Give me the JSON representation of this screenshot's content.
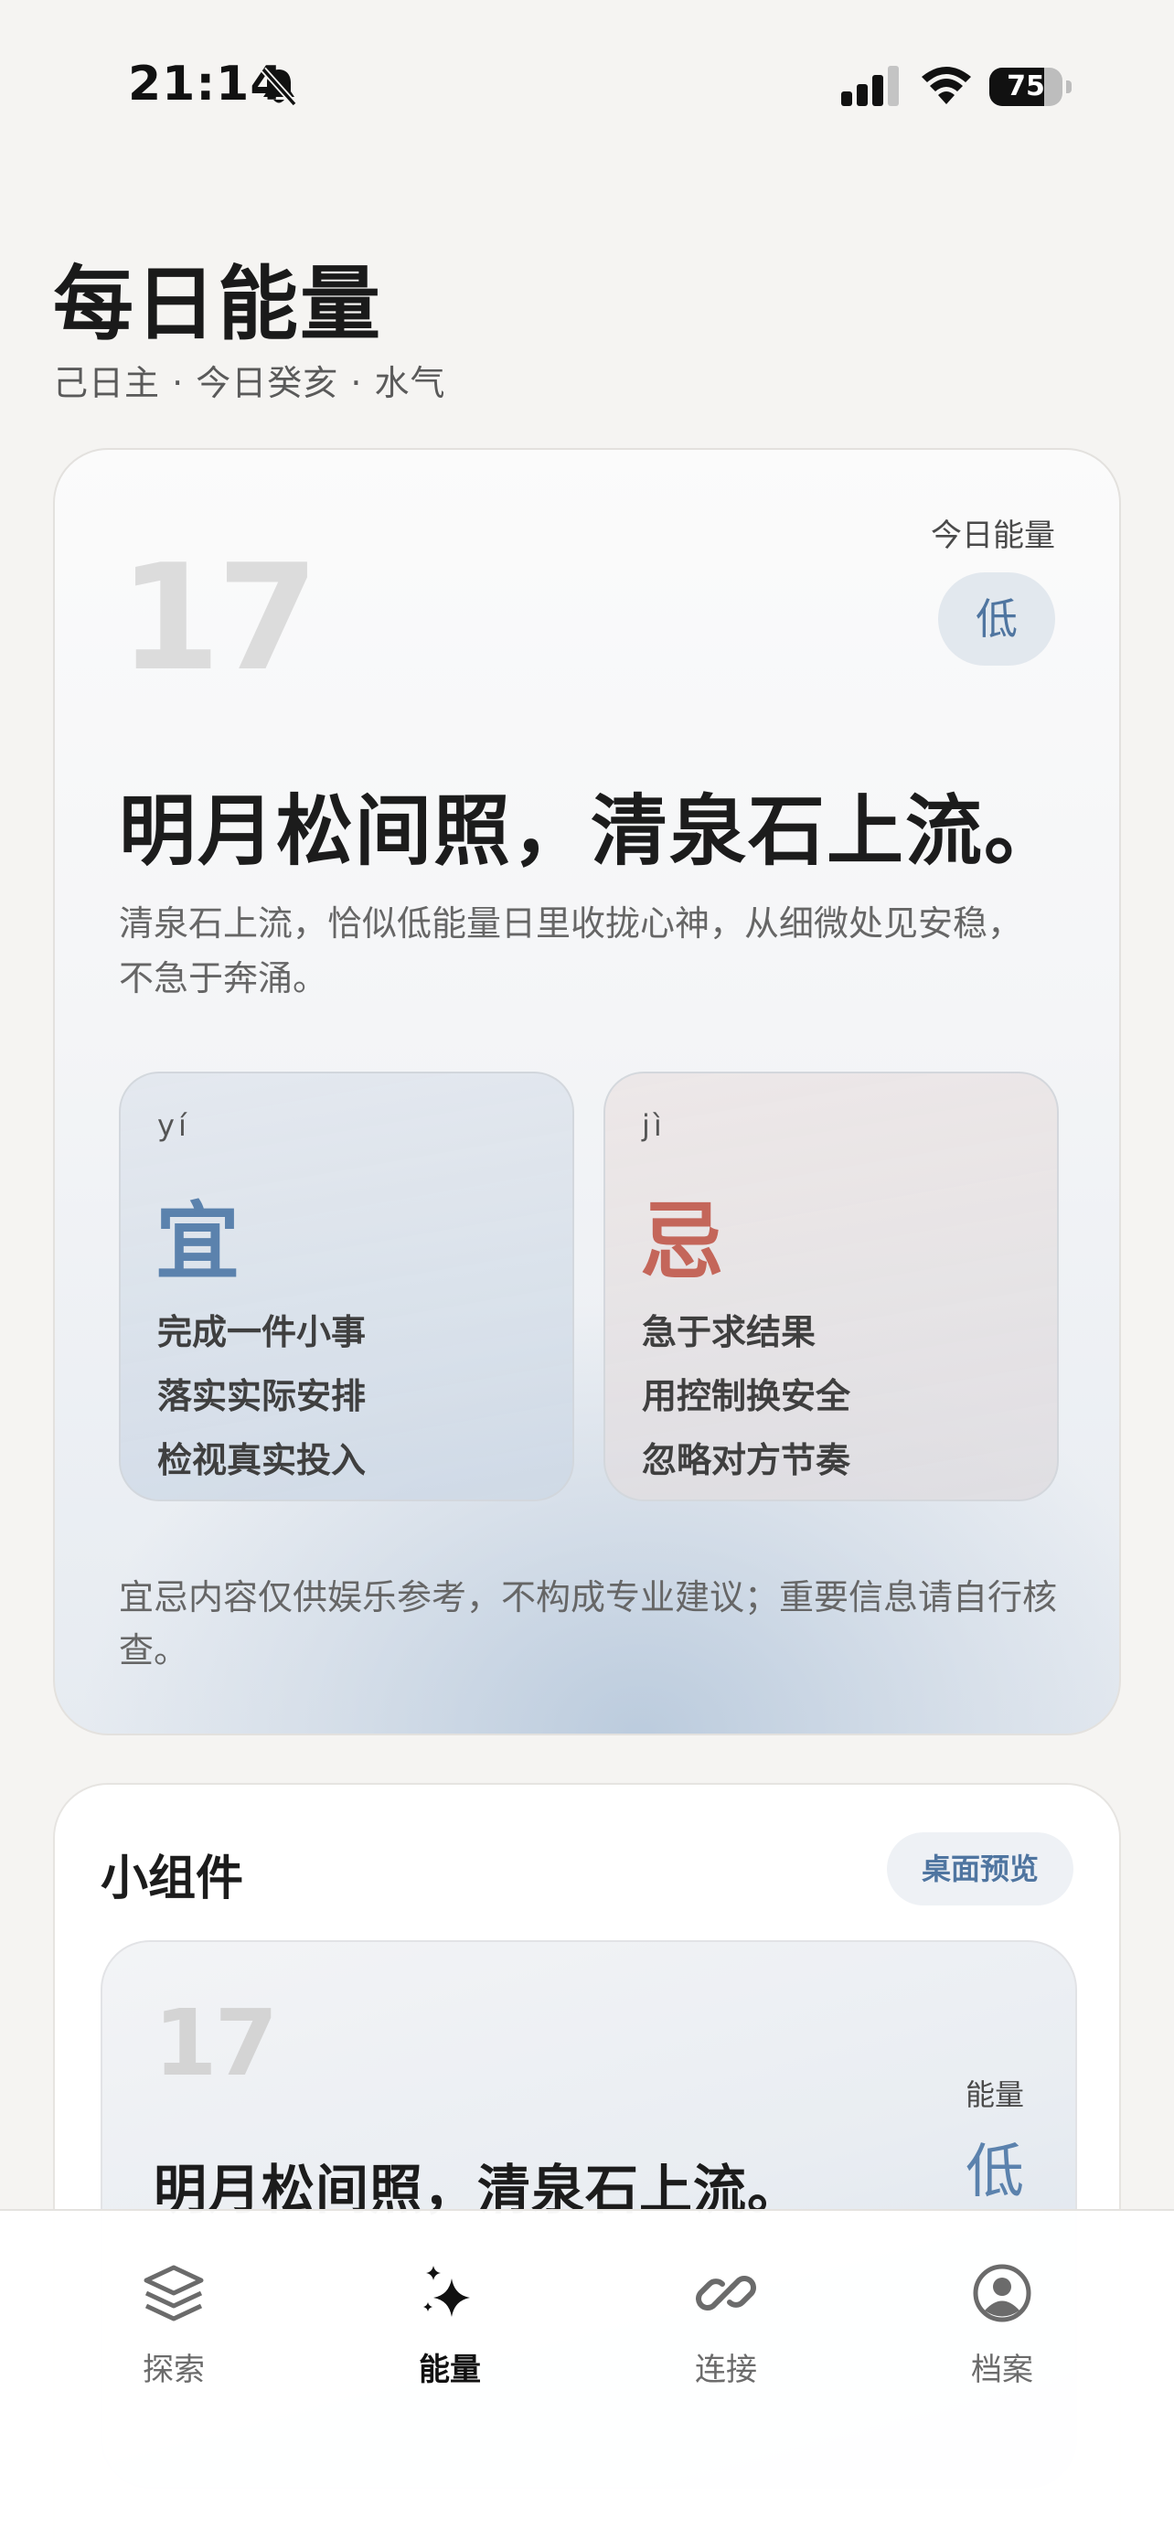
{
  "status_bar": {
    "time": "21:14",
    "battery_level": 75,
    "battery_text": "75",
    "icons": [
      "bell-slash-icon",
      "cellular-signal-icon",
      "wifi-icon",
      "battery-icon"
    ]
  },
  "header": {
    "title": "每日能量",
    "subtitle": "己日主 · 今日癸亥 · 水气"
  },
  "energy_card": {
    "date": "17",
    "energy_label": "今日能量",
    "energy_level": "低",
    "poem": "明月松间照，清泉石上流。",
    "description": "清泉石上流，恰似低能量日里收拢心神，从细微处见安稳，不急于奔涌。",
    "yi": {
      "pinyin": "yí",
      "char": "宜",
      "items": [
        "完成一件小事",
        "落实实际安排",
        "检视真实投入"
      ]
    },
    "ji": {
      "pinyin": "jì",
      "char": "忌",
      "items": [
        "急于求结果",
        "用控制换安全",
        "忽略对方节奏"
      ]
    },
    "disclaimer": "宜忌内容仅供娱乐参考，不构成专业建议；重要信息请自行核查。"
  },
  "widget_section": {
    "title": "小组件",
    "preview_button": "桌面预览",
    "preview": {
      "date": "17",
      "energy_label": "能量",
      "energy_level": "低",
      "poem": "明月松间照，清泉石上流。"
    }
  },
  "tabbar": {
    "tabs": [
      {
        "label": "探索",
        "icon": "layers-icon",
        "active": false
      },
      {
        "label": "能量",
        "icon": "sparkle-icon",
        "active": true
      },
      {
        "label": "连接",
        "icon": "link-icon",
        "active": false
      },
      {
        "label": "档案",
        "icon": "user-circle-icon",
        "active": false
      }
    ]
  },
  "colors": {
    "accent_blue": "#5b82ad",
    "accent_red": "#c4665a",
    "background": "#f5f4f2"
  }
}
